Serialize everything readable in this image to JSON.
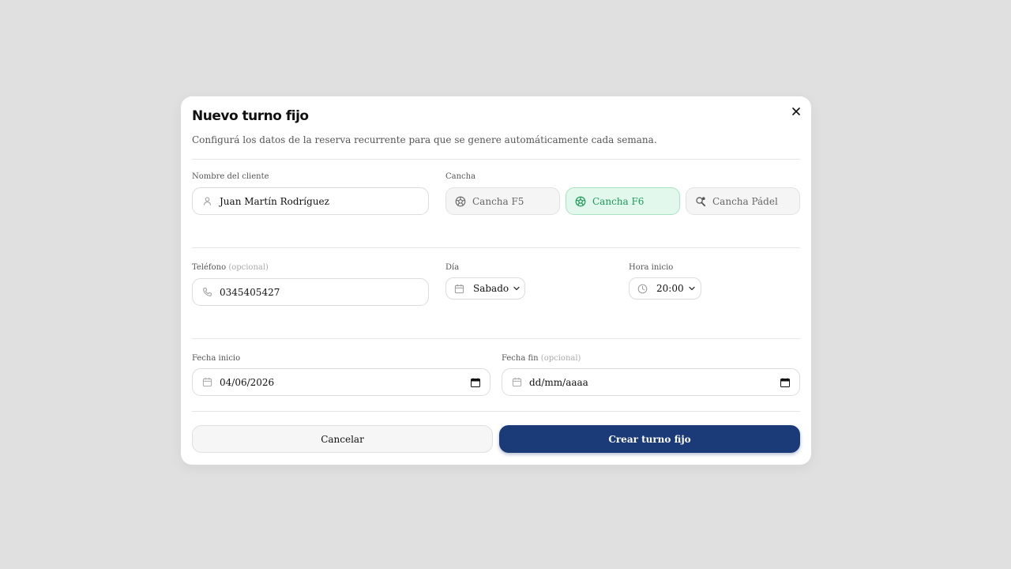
{
  "modal": {
    "title": "Nuevo turno fijo",
    "subtitle": "Configurá los datos de la reserva recurrente para que se genere automáticamente cada semana."
  },
  "cliente": {
    "label": "Nombre del cliente",
    "value": "Juan Martín Rodríguez"
  },
  "cancha": {
    "label": "Cancha",
    "options": [
      "Cancha F5",
      "Cancha F6",
      "Cancha Pádel"
    ],
    "selected": "Cancha F6"
  },
  "telefono": {
    "label": "Teléfono",
    "optional": "(opcional)",
    "value": "0345405427"
  },
  "dia": {
    "label": "Día",
    "value": "Sabado"
  },
  "hora": {
    "label": "Hora inicio",
    "value": "20:00"
  },
  "fecha_inicio": {
    "label": "Fecha inicio",
    "value": "04/06/2026"
  },
  "fecha_fin": {
    "label": "Fecha fin",
    "optional": "(opcional)",
    "value": "dd/mm/aaaa"
  },
  "actions": {
    "cancel_label": "Cancelar",
    "create_label": "Crear turno fijo"
  },
  "colors": {
    "primary": "#1b3a78",
    "selected_bg": "#e3f8ec",
    "selected_text": "#1e9a5a"
  },
  "icons": {
    "close": "close-icon",
    "user": "user-icon",
    "phone": "phone-icon",
    "calendar": "calendar-icon",
    "clock": "clock-icon",
    "ball": "soccer-ball-icon",
    "padel": "padel-racket-icon",
    "chevron": "chevron-down-icon"
  }
}
